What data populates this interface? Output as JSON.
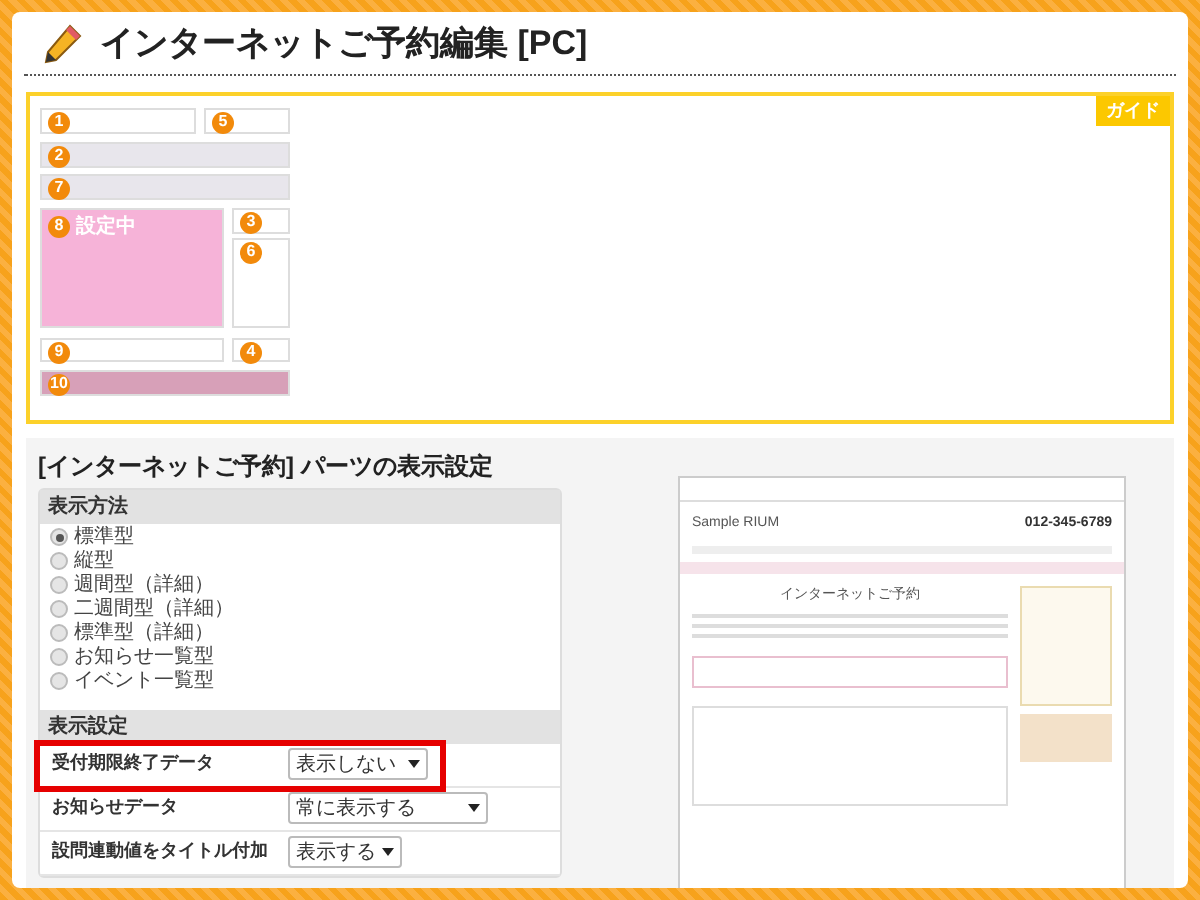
{
  "page_title": "インターネットご予約編集 [PC]",
  "guide": {
    "badge": "ガイド",
    "layout_parts": [
      {
        "number": "1",
        "selected": false
      },
      {
        "number": "5",
        "selected": false
      },
      {
        "number": "2",
        "selected": false
      },
      {
        "number": "7",
        "selected": false
      },
      {
        "number": "8",
        "selected": true,
        "status": "設定中"
      },
      {
        "number": "3",
        "selected": false
      },
      {
        "number": "6",
        "selected": false
      },
      {
        "number": "9",
        "selected": false
      },
      {
        "number": "4",
        "selected": false
      },
      {
        "number": "10",
        "selected": false
      }
    ]
  },
  "settings": {
    "title": "[インターネットご予約] パーツの表示設定",
    "display_method": {
      "heading": "表示方法",
      "options": [
        {
          "label": "標準型",
          "selected": true
        },
        {
          "label": "縦型",
          "selected": false
        },
        {
          "label": "週間型（詳細）",
          "selected": false
        },
        {
          "label": "二週間型（詳細）",
          "selected": false
        },
        {
          "label": "標準型（詳細）",
          "selected": false
        },
        {
          "label": "お知らせ一覧型",
          "selected": false
        },
        {
          "label": "イベント一覧型",
          "selected": false
        }
      ]
    },
    "display_settings": {
      "heading": "表示設定",
      "rows": [
        {
          "label": "受付期限終了データ",
          "value": "表示しない",
          "highlighted": true
        },
        {
          "label": "お知らせデータ",
          "value": "常に表示する",
          "highlighted": false
        },
        {
          "label": "設問連動値をタイトル付加",
          "value": "表示する",
          "highlighted": false
        }
      ]
    }
  },
  "preview": {
    "site_name": "Sample RIUM",
    "phone": "012-345-6789",
    "page_heading": "インターネットご予約"
  }
}
